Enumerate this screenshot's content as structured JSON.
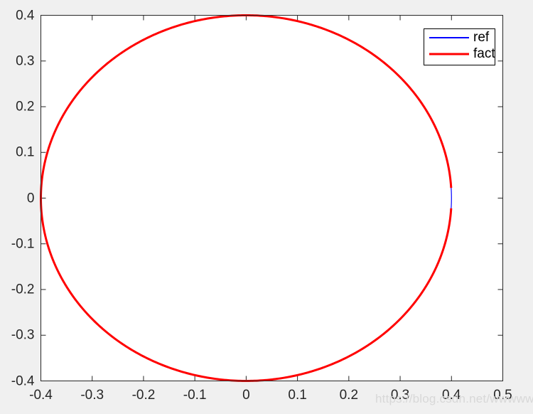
{
  "figure": {
    "background_color": "#f0f0f0",
    "axes_background_color": "#ffffff",
    "axes_edge_color": "#262626"
  },
  "watermark": {
    "text": "https://blog.csdn.net/wwwwwy",
    "color": "#d8d8d8"
  },
  "legend": {
    "position": "top-right",
    "entries": [
      {
        "label": "ref",
        "color": "#0000ff",
        "linewidth": 1.2
      },
      {
        "label": "fact",
        "color": "#ff0000",
        "linewidth": 3
      }
    ]
  },
  "chart_data": {
    "type": "line",
    "title": "",
    "xlabel": "",
    "ylabel": "",
    "xlim": [
      -0.4,
      0.5
    ],
    "ylim": [
      -0.4,
      0.4
    ],
    "xticks": [
      -0.4,
      -0.3,
      -0.2,
      -0.1,
      0,
      0.1,
      0.2,
      0.3,
      0.4,
      0.5
    ],
    "xticklabels": [
      "-0.4",
      "-0.3",
      "-0.2",
      "-0.1",
      "0",
      "0.1",
      "0.2",
      "0.3",
      "0.4",
      "0.5"
    ],
    "yticks": [
      -0.4,
      -0.3,
      -0.2,
      -0.1,
      0,
      0.1,
      0.2,
      0.3,
      0.4
    ],
    "yticklabels": [
      "-0.4",
      "-0.3",
      "-0.2",
      "-0.1",
      "0",
      "0.1",
      "0.2",
      "0.3",
      "0.4"
    ],
    "grid": false,
    "legend_position": "upper right",
    "aspect": "equal",
    "description": "Two nearly coincident circular trajectories of radius 0.4 centred at the origin; the red 'fact' track overplots the blue 'ref' track everywhere except a short arc near (0.4, 0) where the blue reference shows through.",
    "series": [
      {
        "name": "ref",
        "color": "#0000ff",
        "linewidth": 1.2,
        "shape": "circle",
        "center": [
          0,
          0
        ],
        "radius": 0.4,
        "start_angle_deg": 0,
        "end_angle_deg": 360,
        "x": [
          0.4,
          0.3864,
          0.3759,
          0.3625,
          0.3464,
          0.3277,
          0.3064,
          0.2828,
          0.2571,
          0.2294,
          0.2,
          0.1691,
          0.1368,
          0.1035,
          0.0695,
          0.0349,
          0,
          -0.0349,
          -0.0695,
          -0.1035,
          -0.1368,
          -0.1691,
          -0.2,
          -0.2294,
          -0.2571,
          -0.2828,
          -0.3064,
          -0.3277,
          -0.3464,
          -0.3625,
          -0.3759,
          -0.3864,
          -0.394,
          -0.3985,
          -0.4,
          -0.3985,
          -0.394,
          -0.3864,
          -0.3759,
          -0.3625,
          -0.3464,
          -0.3277,
          -0.3064,
          -0.2828,
          -0.2571,
          -0.2294,
          -0.2,
          -0.1691,
          -0.1368,
          -0.1035,
          -0.0695,
          -0.0349,
          0,
          0.0349,
          0.0695,
          0.1035,
          0.1368,
          0.1691,
          0.2,
          0.2294,
          0.2571,
          0.2828,
          0.3064,
          0.3277,
          0.3464,
          0.3625,
          0.3759,
          0.3864,
          0.394,
          0.3985,
          0.4
        ],
        "y": [
          0,
          0.1035,
          0.1368,
          0.1691,
          0.2,
          0.2294,
          0.2571,
          0.2828,
          0.3064,
          0.3277,
          0.3464,
          0.3625,
          0.3759,
          0.3864,
          0.394,
          0.3985,
          0.4,
          0.3985,
          0.394,
          0.3864,
          0.3759,
          0.3625,
          0.3464,
          0.3277,
          0.3064,
          0.2828,
          0.2571,
          0.2294,
          0.2,
          0.1691,
          0.1368,
          0.1035,
          0.0695,
          0.0349,
          0,
          -0.0349,
          -0.0695,
          -0.1035,
          -0.1368,
          -0.1691,
          -0.2,
          -0.2294,
          -0.2571,
          -0.2828,
          -0.3064,
          -0.3277,
          -0.3464,
          -0.3625,
          -0.3759,
          -0.3864,
          -0.394,
          -0.3985,
          -0.4,
          -0.3985,
          -0.394,
          -0.3864,
          -0.3759,
          -0.3625,
          -0.3464,
          -0.3277,
          -0.3064,
          -0.2828,
          -0.2571,
          -0.2294,
          -0.2,
          -0.1691,
          -0.1368,
          -0.1035,
          -0.0695,
          -0.0349,
          0
        ]
      },
      {
        "name": "fact",
        "color": "#ff0000",
        "linewidth": 3,
        "shape": "circle",
        "center": [
          0,
          0
        ],
        "radius": 0.4,
        "start_angle_deg": 3.2,
        "end_angle_deg": 356.8,
        "gap_note": "small break in the red trace near (0.4, 0) exposing the blue ref line"
      }
    ]
  }
}
